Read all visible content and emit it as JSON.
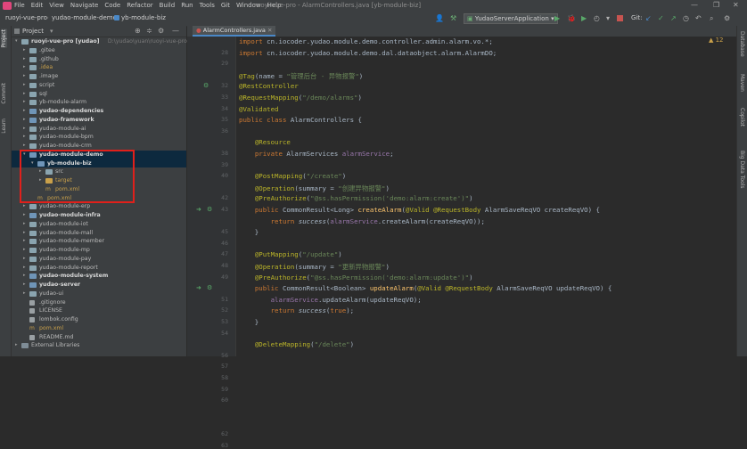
{
  "menu": {
    "items": [
      "File",
      "Edit",
      "View",
      "Navigate",
      "Code",
      "Refactor",
      "Build",
      "Run",
      "Tools",
      "Git",
      "Window",
      "Help"
    ],
    "window_title": "ruoyi-vue-pro - AlarmControllers.java [yb-module-biz]"
  },
  "navbar": {
    "breadcrumb": [
      "ruoyi-vue-pro",
      "yudao-module-demo",
      "yb-module-biz"
    ],
    "run_config": "YudaoServerApplication",
    "git_label": "Git:"
  },
  "project_panel": {
    "title": "Project",
    "tree": [
      {
        "label": "ruoyi-vue-pro [yudao]",
        "extra": "D:\\yudao\\yuan\\ruoyi-vue-pro",
        "indent": 0,
        "arrow": "▾",
        "icon": "folder",
        "color": "#d9d9d9",
        "bold": true
      },
      {
        "label": ".gitee",
        "indent": 1,
        "arrow": "▸",
        "icon": "folder",
        "color": "#bbbbbb"
      },
      {
        "label": ".github",
        "indent": 1,
        "arrow": "▸",
        "icon": "folder",
        "color": "#bbbbbb"
      },
      {
        "label": ".idea",
        "indent": 1,
        "arrow": "▸",
        "icon": "folder",
        "color": "#c9a04a"
      },
      {
        "label": ".image",
        "indent": 1,
        "arrow": "▸",
        "icon": "folder",
        "color": "#bbbbbb"
      },
      {
        "label": "script",
        "indent": 1,
        "arrow": "▸",
        "icon": "folder",
        "color": "#bbbbbb"
      },
      {
        "label": "sql",
        "indent": 1,
        "arrow": "▸",
        "icon": "folder",
        "color": "#bbbbbb"
      },
      {
        "label": "yb-module-alarm",
        "indent": 1,
        "arrow": "▸",
        "icon": "folder",
        "color": "#bbbbbb"
      },
      {
        "label": "yudao-dependencies",
        "indent": 1,
        "arrow": "▸",
        "icon": "module",
        "color": "#d9d9d9",
        "bold": true
      },
      {
        "label": "yudao-framework",
        "indent": 1,
        "arrow": "▸",
        "icon": "module",
        "color": "#d9d9d9",
        "bold": true
      },
      {
        "label": "yudao-module-ai",
        "indent": 1,
        "arrow": "▸",
        "icon": "folder",
        "color": "#bbbbbb"
      },
      {
        "label": "yudao-module-bpm",
        "indent": 1,
        "arrow": "▸",
        "icon": "folder",
        "color": "#bbbbbb"
      },
      {
        "label": "yudao-module-crm",
        "indent": 1,
        "arrow": "▸",
        "icon": "folder",
        "color": "#bbbbbb"
      },
      {
        "label": "yudao-module-demo",
        "indent": 1,
        "arrow": "▾",
        "icon": "module",
        "color": "#d9d9d9",
        "bold": true,
        "sel": true
      },
      {
        "label": "yb-module-biz",
        "indent": 2,
        "arrow": "▾",
        "icon": "module",
        "color": "#d9d9d9",
        "bold": true,
        "sel": true
      },
      {
        "label": "src",
        "indent": 3,
        "arrow": "▸",
        "icon": "folder",
        "color": "#bbbbbb"
      },
      {
        "label": "target",
        "indent": 3,
        "arrow": "▸",
        "icon": "folder-orange",
        "color": "#c9a04a"
      },
      {
        "label": "pom.xml",
        "indent": 3,
        "arrow": "",
        "icon": "maven",
        "color": "#c9a04a"
      },
      {
        "label": "pom.xml",
        "indent": 2,
        "arrow": "",
        "icon": "maven",
        "color": "#c9a04a"
      },
      {
        "label": "yudao-module-erp",
        "indent": 1,
        "arrow": "▸",
        "icon": "folder",
        "color": "#bbbbbb"
      },
      {
        "label": "yudao-module-infra",
        "indent": 1,
        "arrow": "▸",
        "icon": "module",
        "color": "#d9d9d9",
        "bold": true
      },
      {
        "label": "yudao-module-iot",
        "indent": 1,
        "arrow": "▸",
        "icon": "folder",
        "color": "#bbbbbb"
      },
      {
        "label": "yudao-module-mall",
        "indent": 1,
        "arrow": "▸",
        "icon": "folder",
        "color": "#bbbbbb"
      },
      {
        "label": "yudao-module-member",
        "indent": 1,
        "arrow": "▸",
        "icon": "folder",
        "color": "#bbbbbb"
      },
      {
        "label": "yudao-module-mp",
        "indent": 1,
        "arrow": "▸",
        "icon": "folder",
        "color": "#bbbbbb"
      },
      {
        "label": "yudao-module-pay",
        "indent": 1,
        "arrow": "▸",
        "icon": "folder",
        "color": "#bbbbbb"
      },
      {
        "label": "yudao-module-report",
        "indent": 1,
        "arrow": "▸",
        "icon": "folder",
        "color": "#bbbbbb"
      },
      {
        "label": "yudao-module-system",
        "indent": 1,
        "arrow": "▸",
        "icon": "module",
        "color": "#d9d9d9",
        "bold": true
      },
      {
        "label": "yudao-server",
        "indent": 1,
        "arrow": "▸",
        "icon": "module",
        "color": "#d9d9d9",
        "bold": true
      },
      {
        "label": "yudao-ui",
        "indent": 1,
        "arrow": "▸",
        "icon": "folder",
        "color": "#bbbbbb"
      },
      {
        "label": ".gitignore",
        "indent": 1,
        "arrow": "",
        "icon": "file",
        "color": "#bbbbbb"
      },
      {
        "label": "LICENSE",
        "indent": 1,
        "arrow": "",
        "icon": "file",
        "color": "#bbbbbb"
      },
      {
        "label": "lombok.config",
        "indent": 1,
        "arrow": "",
        "icon": "file",
        "color": "#bbbbbb"
      },
      {
        "label": "pom.xml",
        "indent": 1,
        "arrow": "",
        "icon": "maven",
        "color": "#c9a04a"
      },
      {
        "label": "README.md",
        "indent": 1,
        "arrow": "",
        "icon": "file",
        "color": "#bbbbbb"
      },
      {
        "label": "External Libraries",
        "indent": 0,
        "arrow": "▸",
        "icon": "lib",
        "color": "#bbbbbb"
      }
    ]
  },
  "left_strip": [
    "Project",
    "Commit",
    "Learn"
  ],
  "right_strip": [
    "Database",
    "Maven",
    "Copilot",
    "Big Data Tools"
  ],
  "editor": {
    "tab_label": "AlarmControllers.java",
    "line_numbers": [
      "",
      "28",
      "29",
      "",
      "32",
      "33",
      "34",
      "35",
      "36",
      "",
      "38",
      "39",
      "40",
      "",
      "42",
      "43",
      "",
      "45",
      "46",
      "47",
      "48",
      "49",
      "",
      "51",
      "52",
      "53",
      "54",
      "",
      "56",
      "57",
      "58",
      "59",
      "60",
      "",
      "",
      "62",
      "63",
      "",
      ""
    ],
    "code_lines": [
      "import cn.iocoder.yudao.module.demo.controller.admin.alarm.vo.*;",
      "import cn.iocoder.yudao.module.demo.dal.dataobject.alarm.AlarmDO;",
      "",
      "@Tag(name = \"管理后台 - 异物报警\")",
      "@RestController",
      "@RequestMapping(\"/demo/alarms\")",
      "@Validated",
      "public class AlarmControllers {",
      "",
      "    @Resource",
      "    private AlarmServices alarmService;",
      "",
      "    @PostMapping(\"/create\")",
      "    @Operation(summary = \"创建异物报警\")",
      "    @PreAuthorize(\"@ss.hasPermission('demo:alarm:create')\")",
      "    public CommonResult<Long> createAlarm(@Valid @RequestBody AlarmSaveReqVO createReqVO) {",
      "        return success(alarmService.createAlarm(createReqVO));",
      "    }",
      "",
      "    @PutMapping(\"/update\")",
      "    @Operation(summary = \"更新异物报警\")",
      "    @PreAuthorize(\"@ss.hasPermission('demo:alarm:update')\")",
      "    public CommonResult<Boolean> updateAlarm(@Valid @RequestBody AlarmSaveReqVO updateReqVO) {",
      "        alarmService.updateAlarm(updateReqVO);",
      "        return success(true);",
      "    }",
      "",
      "    @DeleteMapping(\"/delete\")"
    ],
    "warnings": "▲ 12"
  },
  "colors": {
    "accent": "#4a88c7",
    "highlight_box": "#e0201b",
    "selection": "#0d293e",
    "background": "#2b2b2b"
  }
}
